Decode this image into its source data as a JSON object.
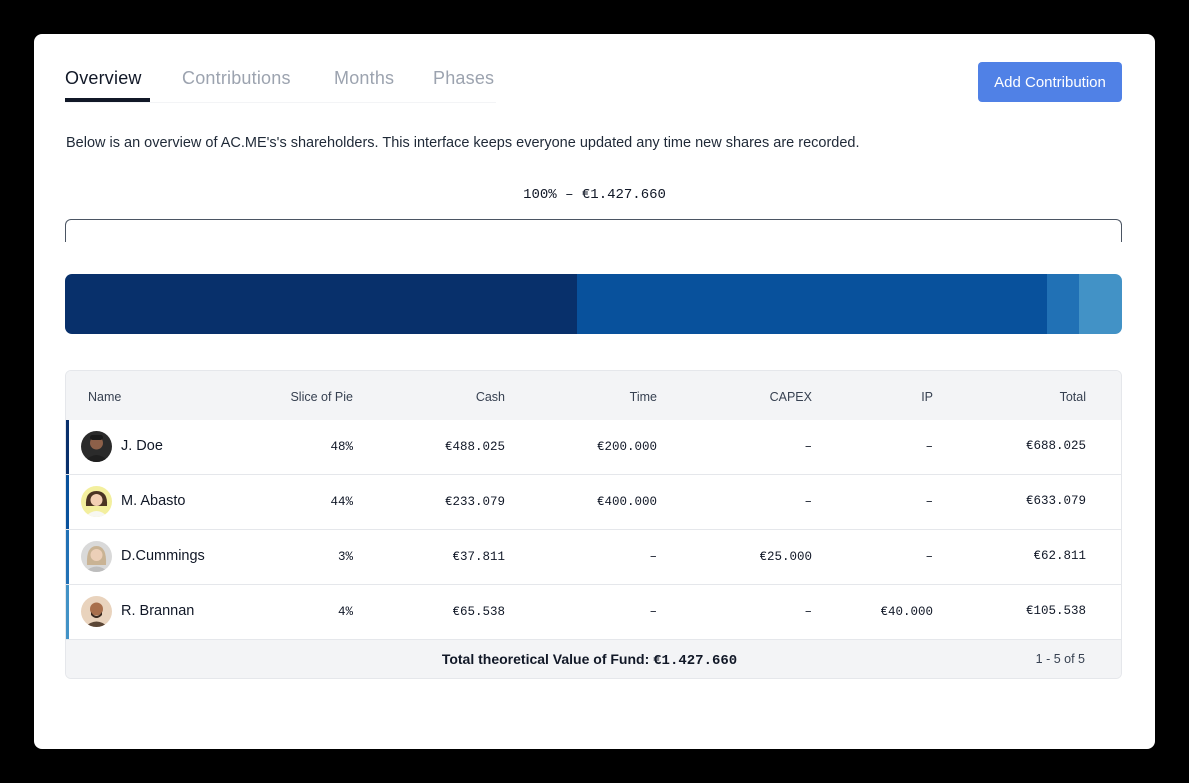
{
  "tabs": [
    {
      "label": "Overview",
      "active": true
    },
    {
      "label": "Contributions",
      "active": false
    },
    {
      "label": "Months",
      "active": false
    },
    {
      "label": "Phases",
      "active": false
    }
  ],
  "actions": {
    "add_contribution_label": "Add Contribution"
  },
  "intro_text": "Below is an overview of AC.ME's's shareholders. This interface keeps everyone updated any time new shares are recorded.",
  "total_label": "100% – €1.427.660",
  "colors": {
    "accent": "#5081e6",
    "segments": [
      "#08306b",
      "#08519c",
      "#2171b5",
      "#4292c6"
    ]
  },
  "bar_segments": [
    {
      "share": 0.48
    },
    {
      "share": 0.44
    },
    {
      "share": 0.03
    },
    {
      "share": 0.04
    }
  ],
  "table": {
    "columns": [
      "Name",
      "Slice of Pie",
      "Cash",
      "Time",
      "CAPEX",
      "IP",
      "Total"
    ],
    "rows": [
      {
        "name": "J. Doe",
        "slice": "48%",
        "cash": "€488.025",
        "time": "€200.000",
        "capex": "–",
        "ip": "–",
        "total": "€688.025"
      },
      {
        "name": "M. Abasto",
        "slice": "44%",
        "cash": "€233.079",
        "time": "€400.000",
        "capex": "–",
        "ip": "–",
        "total": "€633.079"
      },
      {
        "name": "D.Cummings",
        "slice": "3%",
        "cash": "€37.811",
        "time": "–",
        "capex": "€25.000",
        "ip": "–",
        "total": "€62.811"
      },
      {
        "name": "R. Brannan",
        "slice": "4%",
        "cash": "€65.538",
        "time": "–",
        "capex": "–",
        "ip": "€40.000",
        "total": "€105.538"
      }
    ],
    "footer": {
      "fund_label": "Total theoretical Value of Fund:",
      "fund_value": "€1.427.660",
      "pagination": "1 - 5 of 5"
    }
  }
}
